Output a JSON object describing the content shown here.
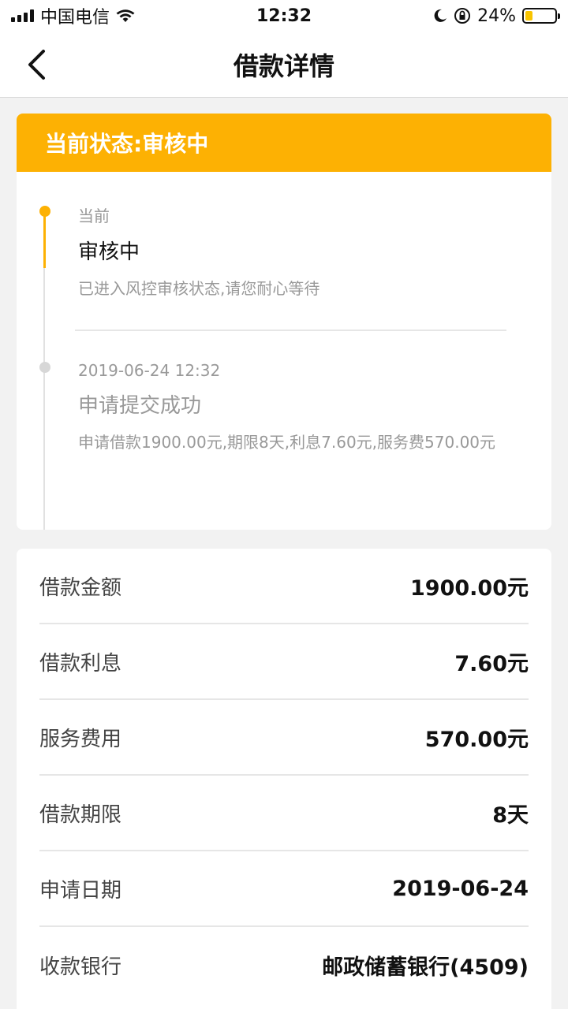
{
  "status_bar": {
    "carrier": "中国电信",
    "time": "12:32",
    "battery_percent": "24%",
    "battery_level": 0.24
  },
  "nav": {
    "title": "借款详情"
  },
  "status_card": {
    "header": "当前状态:审核中",
    "current": {
      "label": "当前",
      "title": "审核中",
      "desc": "已进入风控审核状态,请您耐心等待"
    },
    "past": {
      "time": "2019-06-24 12:32",
      "title": "申请提交成功",
      "desc": "申请借款1900.00元,期限8天,利息7.60元,服务费570.00元"
    }
  },
  "details": [
    {
      "label": "借款金额",
      "value": "1900.00元"
    },
    {
      "label": "借款利息",
      "value": "7.60元"
    },
    {
      "label": "服务费用",
      "value": "570.00元"
    },
    {
      "label": "借款期限",
      "value": "8天"
    },
    {
      "label": "申请日期",
      "value": "2019-06-24"
    },
    {
      "label": "收款银行",
      "value": "邮政储蓄银行(4509)"
    }
  ],
  "colors": {
    "accent": "#fdb103"
  }
}
